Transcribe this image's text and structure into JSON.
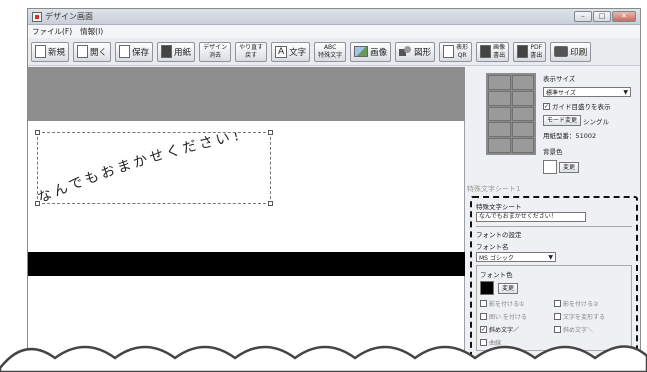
{
  "window": {
    "title": "デザイン画面"
  },
  "menu": {
    "items": [
      "ファイル(F)",
      "情報(I)"
    ]
  },
  "toolbar": {
    "new_label": "新規",
    "open_label": "開く",
    "save_label": "保存",
    "paper_label": "用紙",
    "design_clear_top": "デザイン",
    "design_clear_bottom": "消去",
    "redo_top": "やり直す",
    "redo_bottom": "戻す",
    "text_label": "文字",
    "special_text_top": "ABC",
    "special_text_bottom": "特殊文字",
    "image_label": "画像",
    "shape_label": "図形",
    "table_qr_top": "表形",
    "table_qr_bottom": "QR",
    "image_out_top": "画像",
    "image_out_bottom": "書出",
    "pdf_top": "PDF",
    "pdf_bottom": "書出",
    "print_label": "印刷"
  },
  "canvas": {
    "text_content": "なんでもおまかせください！"
  },
  "side": {
    "display_size_label": "表示サイズ",
    "display_size_value": "標準サイズ",
    "guide_label": "ガイド目盛りを表示",
    "mode_button": "モード変更",
    "mode_value": "シングル",
    "paper_code": "用紙型番：51002",
    "bg_color_label": "背景色",
    "change_label": "変更"
  },
  "sheet_tab": "特殊文字シート1",
  "props": {
    "title": "特殊文字シート",
    "text_value": "なんでもおまかせください！",
    "font_settings": "フォントの設定",
    "font_name_label": "フォント名",
    "font_name_value": "MS ゴシック",
    "font_color_label": "フォント色",
    "change_label": "変更",
    "options": [
      {
        "label": "影を付ける①",
        "checked": false
      },
      {
        "label": "影を付ける②",
        "checked": false
      },
      {
        "label": "囲い を付ける",
        "checked": false
      },
      {
        "label": "文字を変形する",
        "checked": false
      },
      {
        "label": "斜め文字／",
        "checked": true
      },
      {
        "label": "斜め文字＼",
        "checked": false
      },
      {
        "label": "曲線",
        "checked": false
      }
    ]
  }
}
